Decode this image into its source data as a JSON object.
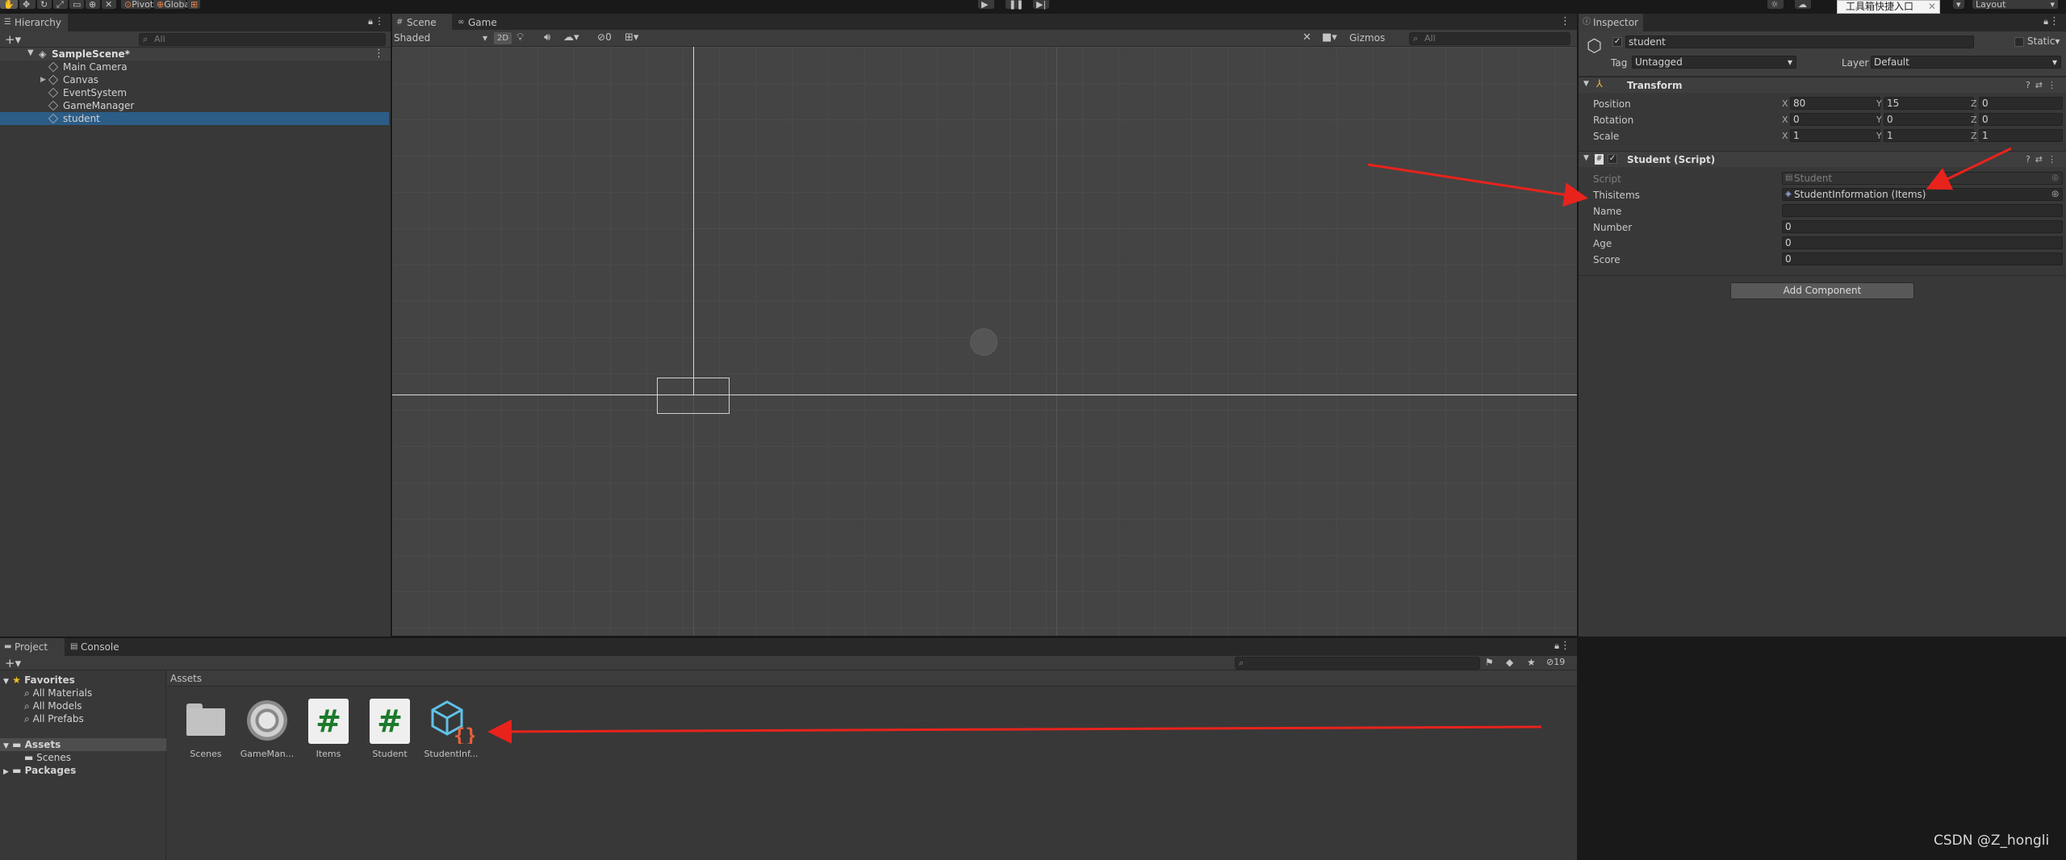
{
  "toolbar": {
    "pivot": "Pivot",
    "global": "Global",
    "layout": "Layout",
    "popup": "工具箱快捷入口"
  },
  "hierarchy": {
    "tab": "Hierarchy",
    "search_placeholder": "All",
    "scene": "SampleScene*",
    "items": [
      {
        "label": "Main Camera",
        "expand": false
      },
      {
        "label": "Canvas",
        "expand": true
      },
      {
        "label": "EventSystem",
        "expand": false
      },
      {
        "label": "GameManager",
        "expand": false
      },
      {
        "label": "student",
        "expand": false,
        "selected": true
      }
    ]
  },
  "scene": {
    "tabs": [
      "Scene",
      "Game"
    ],
    "shading": "Shaded",
    "mode_2d": "2D",
    "hidden_count": "0",
    "gizmos": "Gizmos",
    "search_placeholder": "All"
  },
  "inspector": {
    "tab": "Inspector",
    "object_name": "student",
    "static_label": "Static",
    "tag_label": "Tag",
    "tag_value": "Untagged",
    "layer_label": "Layer",
    "layer_value": "Default",
    "transform": {
      "title": "Transform",
      "rows": [
        {
          "label": "Position",
          "x": "80",
          "y": "15",
          "z": "0"
        },
        {
          "label": "Rotation",
          "x": "0",
          "y": "0",
          "z": "0"
        },
        {
          "label": "Scale",
          "x": "1",
          "y": "1",
          "z": "1"
        }
      ]
    },
    "script": {
      "title": "Student (Script)",
      "fields": [
        {
          "label": "Script",
          "value": "Student",
          "disabled": true,
          "ref": true
        },
        {
          "label": "Thisitems",
          "value": "StudentInformation (Items)",
          "ref": true
        },
        {
          "label": "Name",
          "value": ""
        },
        {
          "label": "Number",
          "value": "0"
        },
        {
          "label": "Age",
          "value": "0"
        },
        {
          "label": "Score",
          "value": "0"
        }
      ]
    },
    "add_component": "Add Component"
  },
  "project": {
    "tabs": [
      "Project",
      "Console"
    ],
    "favorites": "Favorites",
    "favorite_items": [
      "All Materials",
      "All Models",
      "All Prefabs"
    ],
    "assets_root": "Assets",
    "assets_children": [
      "Scenes"
    ],
    "packages": "Packages",
    "breadcrumb": "Assets",
    "hidden_count": "19",
    "assets": [
      {
        "name": "Scenes",
        "icon": "folder-icon"
      },
      {
        "name": "GameMan...",
        "icon": "gear-icon"
      },
      {
        "name": "Items",
        "icon": "csharp-script-icon"
      },
      {
        "name": "Student",
        "icon": "csharp-script-icon"
      },
      {
        "name": "StudentInf...",
        "icon": "scriptable-object-icon"
      }
    ]
  },
  "watermark": "CSDN @Z_hongli",
  "colors": {
    "selection": "#2c5d87",
    "arrow": "#e8231c",
    "panel": "#383838",
    "scene": "#444444"
  }
}
